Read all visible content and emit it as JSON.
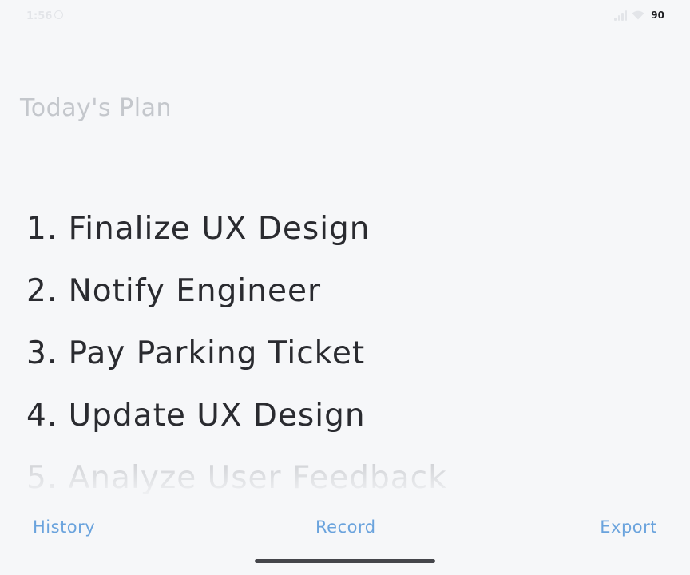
{
  "status_bar": {
    "time": "1:56",
    "battery": "90",
    "icons": [
      "do-not-disturb-icon",
      "signal-icon",
      "wifi-icon"
    ]
  },
  "page": {
    "title": "Today's Plan"
  },
  "plan": {
    "items": [
      "1. Finalize UX Design",
      "2. Notify Engineer",
      "3. Pay Parking Ticket",
      "4. Update UX Design",
      "5. Analyze User Feedback"
    ]
  },
  "nav": {
    "history": "History",
    "record": "Record",
    "export": "Export"
  },
  "colors": {
    "background": "#f6f7f9",
    "title": "#c4c7cc",
    "item_text": "#2a2b30",
    "accent": "#6aa3dd"
  }
}
